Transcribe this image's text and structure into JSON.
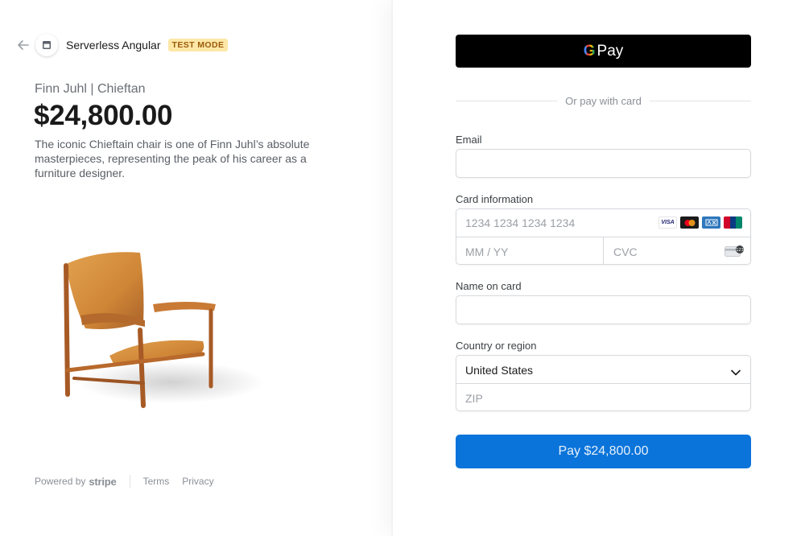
{
  "header": {
    "merchant_name": "Serverless Angular",
    "badge": "TEST MODE",
    "back_icon": "arrow-left-icon",
    "merchant_icon": "store-icon"
  },
  "product": {
    "name": "Finn Juhl | Chieftan",
    "price": "$24,800.00",
    "description": "The iconic Chieftain chair is one of Finn Juhl’s absolute masterpieces, representing the peak of his career as a furniture designer."
  },
  "footer": {
    "powered_by": "Powered by",
    "brand": "stripe",
    "links": [
      "Terms",
      "Privacy"
    ]
  },
  "wallet": {
    "g_letter": "G",
    "label": "Pay"
  },
  "or_text": "Or pay with card",
  "form": {
    "email": {
      "label": "Email",
      "value": ""
    },
    "card": {
      "label": "Card information",
      "number_placeholder": "1234 1234 1234 1234",
      "expiry_placeholder": "MM / YY",
      "cvc_placeholder": "CVC",
      "brands": [
        "VISA",
        "mastercard",
        "amex",
        "unionpay"
      ]
    },
    "name": {
      "label": "Name on card",
      "value": ""
    },
    "country": {
      "label": "Country or region",
      "selected": "United States",
      "zip_placeholder": "ZIP"
    }
  },
  "pay_button": "Pay $24,800.00",
  "colors": {
    "accent": "#0a74da",
    "badge_bg": "#fde7a7",
    "badge_text": "#9a5b0a",
    "wallet_bg": "#000000"
  }
}
